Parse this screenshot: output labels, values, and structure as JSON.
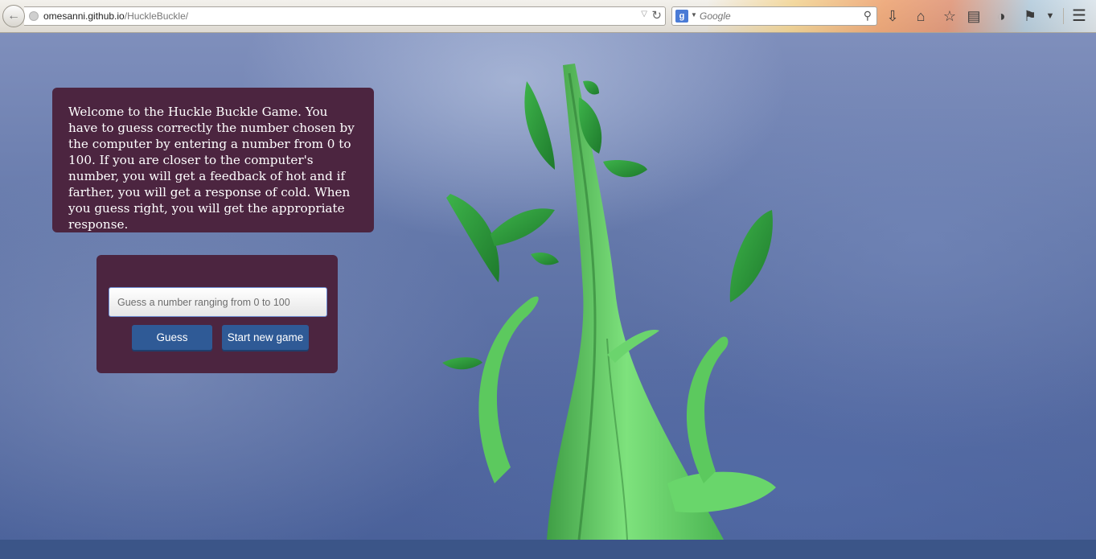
{
  "browser": {
    "url_host": "omesanni.github.io",
    "url_path": "/HuckleBuckle/",
    "search_engine_letter": "g",
    "search_placeholder": "Google"
  },
  "intro": {
    "text": "Welcome to the Huckle Buckle Game. You have to guess correctly the number chosen by the computer by entering a number from 0 to 100. If you are closer to the computer's number, you will get a feedback of hot and if farther, you will get a response of cold. When you guess right, you will get the appropriate response."
  },
  "form": {
    "input_placeholder": "Guess a number ranging from 0 to 100",
    "input_value": "",
    "guess_label": "Guess",
    "new_game_label": "Start new game"
  },
  "colors": {
    "panel": "#4c2540",
    "button": "#2f5a96",
    "sky": "#5469a0",
    "beanstalk": "#5fcf63"
  }
}
